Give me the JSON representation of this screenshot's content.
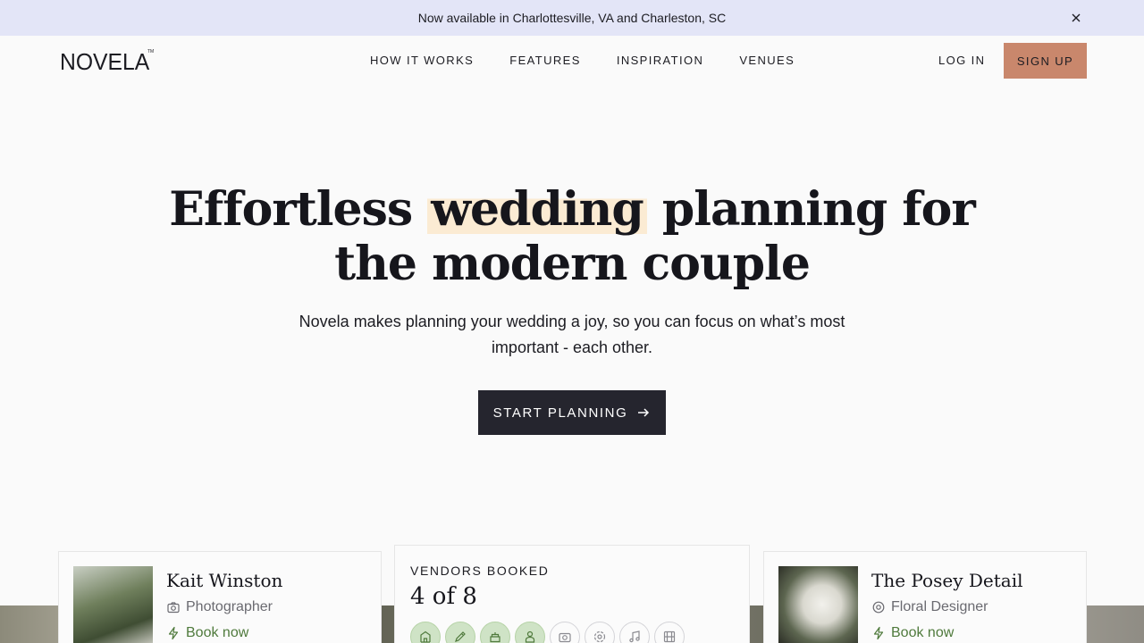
{
  "banner": {
    "text": "Now available in Charlottesville, VA and Charleston, SC"
  },
  "nav": {
    "logo": "NOVELA",
    "logo_tm": "TM",
    "links": [
      "HOW IT WORKS",
      "FEATURES",
      "INSPIRATION",
      "VENUES"
    ],
    "login": "LOG IN",
    "signup": "SIGN UP"
  },
  "hero": {
    "title_before": "Effortless ",
    "title_highlight": "wedding",
    "title_after_line1": " planning for",
    "title_line2": "the modern couple",
    "subtitle": "Novela makes planning your wedding a joy, so you can focus on what’s most important - each other.",
    "cta": "START PLANNING"
  },
  "cards": {
    "left": {
      "name": "Kait Winston",
      "role": "Photographer",
      "action": "Book now"
    },
    "middle": {
      "label": "VENDORS BOOKED",
      "count": "4 of 8",
      "vendors": [
        {
          "icon": "venue-icon",
          "booked": true
        },
        {
          "icon": "planner-pen-icon",
          "booked": true
        },
        {
          "icon": "cake-icon",
          "booked": true
        },
        {
          "icon": "officiant-icon",
          "booked": true
        },
        {
          "icon": "camera-icon",
          "booked": false
        },
        {
          "icon": "flower-icon",
          "booked": false
        },
        {
          "icon": "music-icon",
          "booked": false
        },
        {
          "icon": "film-icon",
          "booked": false
        }
      ]
    },
    "right": {
      "name": "The Posey Detail",
      "role": "Floral Designer",
      "action": "Book now"
    }
  },
  "colors": {
    "banner": "#e3e5f7",
    "signup": "#c9876c",
    "cta": "#25252e",
    "highlight": "#fbebd3",
    "booked": "#cfe3c6",
    "book_now": "#4f7a3c"
  }
}
